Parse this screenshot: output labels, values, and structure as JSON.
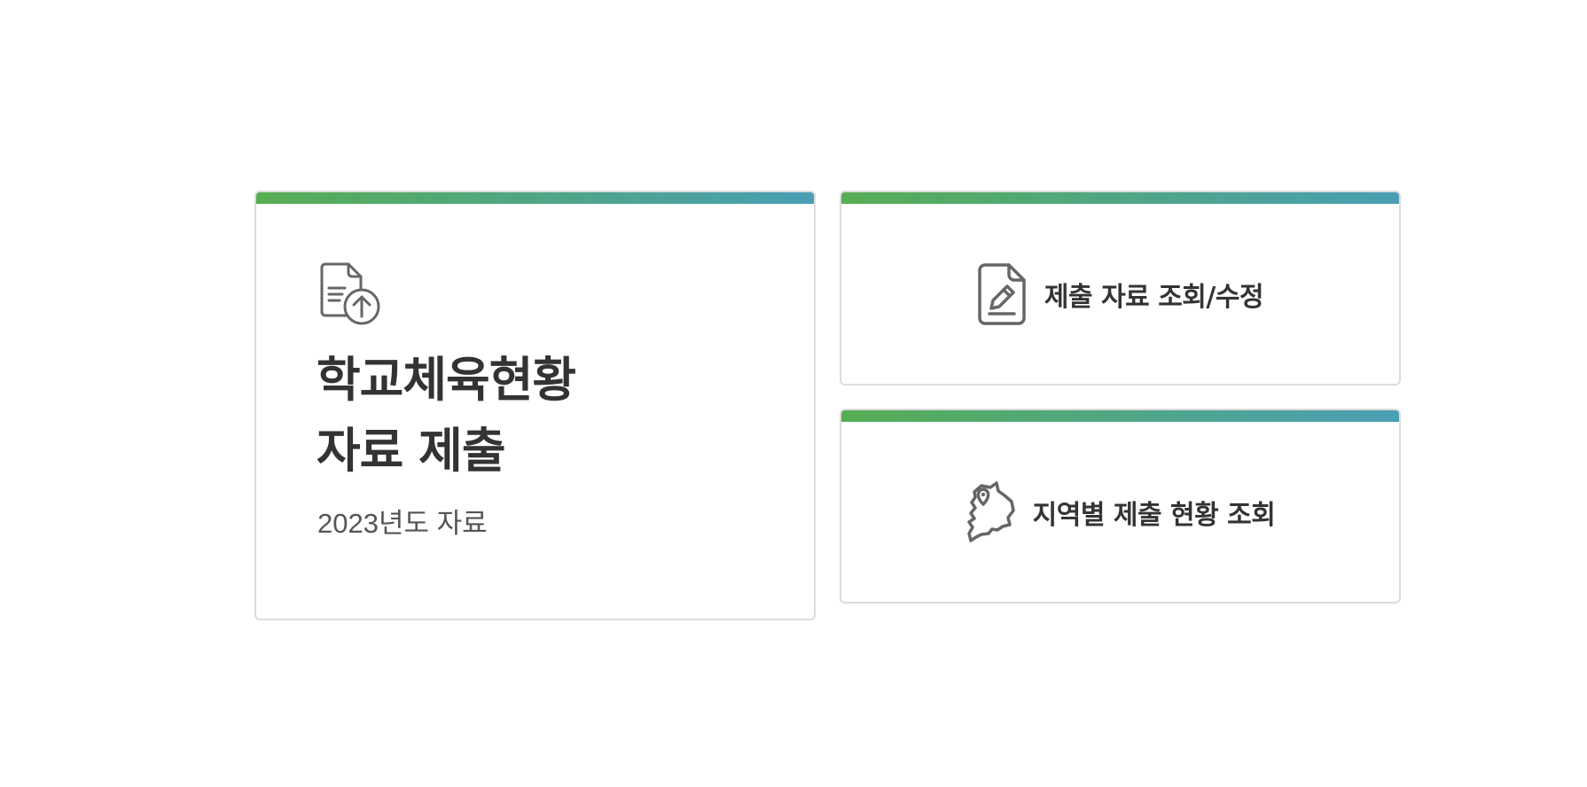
{
  "cards": {
    "main": {
      "icon": "document-upload-icon",
      "title_line1": "학교체육현황",
      "title_line2": "자료 제출",
      "subtitle": "2023년도 자료"
    },
    "edit": {
      "icon": "document-edit-icon",
      "label": "제출 자료 조회/수정"
    },
    "region": {
      "icon": "korea-map-pin-icon",
      "label": "지역별 제출 현황 조회"
    }
  },
  "colors": {
    "accent_gradient_start": "#56ad53",
    "accent_gradient_end": "#4a9fb5",
    "text": "#333333",
    "icon": "#666666",
    "border": "#dcdcdc"
  }
}
